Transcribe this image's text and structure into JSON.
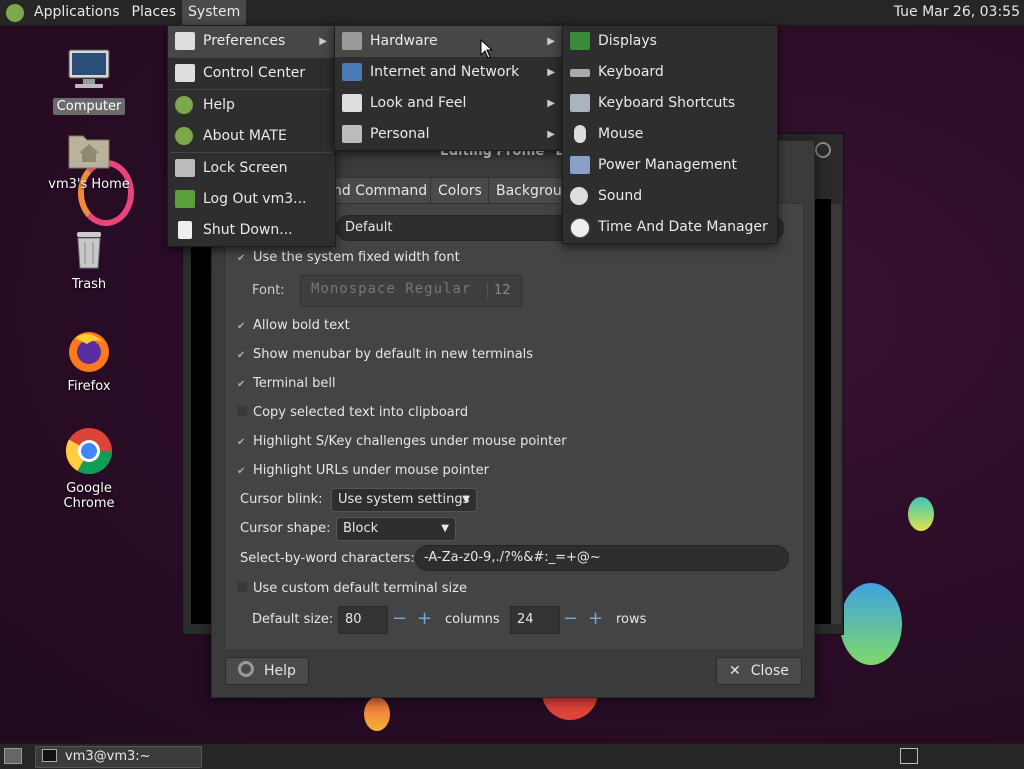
{
  "top_panel": {
    "menus": [
      "Applications",
      "Places",
      "System"
    ],
    "clock": "Tue Mar 26, 03:55"
  },
  "desktop": {
    "icons": [
      {
        "label": "Computer"
      },
      {
        "label": "vm3's Home"
      },
      {
        "label": "Trash"
      },
      {
        "label": "Firefox"
      },
      {
        "label": "Google Chrome"
      }
    ]
  },
  "system_menu": {
    "items": [
      "Preferences",
      "Control Center",
      "Help",
      "About MATE",
      "Lock Screen",
      "Log Out vm3...",
      "Shut Down..."
    ]
  },
  "preferences_menu": {
    "items": [
      "Hardware",
      "Internet and Network",
      "Look and Feel",
      "Personal"
    ]
  },
  "hardware_menu": {
    "items": [
      "Displays",
      "Keyboard",
      "Keyboard Shortcuts",
      "Mouse",
      "Power Management",
      "Sound",
      "Time And Date Manager"
    ]
  },
  "dialog": {
    "title": "Editing Profile \"Def",
    "tabs": [
      "nd Command",
      "Colors",
      "Backgroun"
    ],
    "profile_name": "Default",
    "use_system_font": "Use the system fixed width font",
    "font_label": "Font:",
    "font_value": "Monospace Regular",
    "font_size": "12",
    "allow_bold": "Allow bold text",
    "show_menubar": "Show menubar by default in new terminals",
    "terminal_bell": "Terminal bell",
    "copy_selected": "Copy selected text into clipboard",
    "highlight_skey": "Highlight S/Key challenges under mouse pointer",
    "highlight_urls": "Highlight URLs under mouse pointer",
    "cursor_blink_label": "Cursor blink:",
    "cursor_blink_value": "Use system settings",
    "cursor_shape_label": "Cursor shape:",
    "cursor_shape_value": "Block",
    "select_word_label": "Select-by-word characters:",
    "select_word_value": "-A-Za-z0-9,./?%&#:_=+@~",
    "custom_size": "Use custom default terminal size",
    "default_size_label": "Default size:",
    "columns_value": "80",
    "columns_label": "columns",
    "rows_value": "24",
    "rows_label": "rows",
    "help_button": "Help",
    "close_button": "Close"
  },
  "bottom_panel": {
    "task_label": "vm3@vm3:~"
  }
}
